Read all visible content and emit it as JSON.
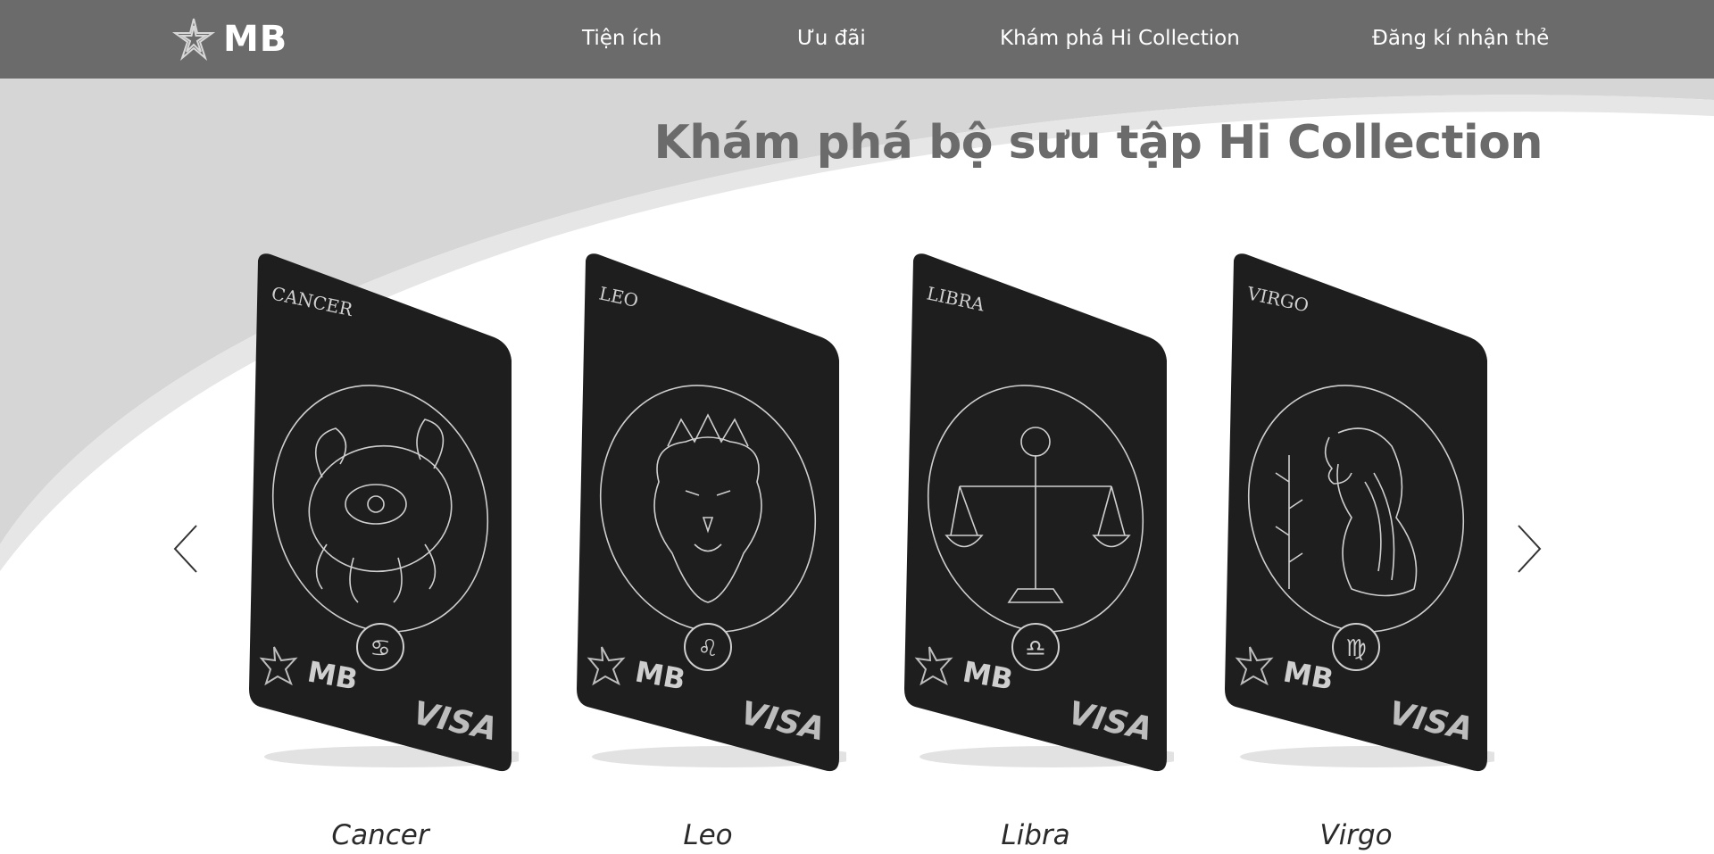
{
  "header": {
    "logo_text": "MB",
    "nav": [
      {
        "label": "Tiện ích"
      },
      {
        "label": "Ưu đãi"
      },
      {
        "label": "Khám phá Hi Collection"
      },
      {
        "label": "Đăng kí nhận thẻ"
      }
    ]
  },
  "main": {
    "title": "Khám phá bộ sưu tập Hi Collection"
  },
  "carousel": {
    "cards": [
      {
        "card_label": "CANCER",
        "caption": "Cancer",
        "symbol": "♋",
        "brand": "MB",
        "network": "VISA"
      },
      {
        "card_label": "LEO",
        "caption": "Leo",
        "symbol": "♌",
        "brand": "MB",
        "network": "VISA"
      },
      {
        "card_label": "LIBRA",
        "caption": "Libra",
        "symbol": "♎",
        "brand": "MB",
        "network": "VISA"
      },
      {
        "card_label": "VIRGO",
        "caption": "Virgo",
        "symbol": "♍",
        "brand": "MB",
        "network": "VISA"
      }
    ]
  },
  "colors": {
    "header_bg": "#6b6b6b",
    "title": "#6b6b6b",
    "card_bg": "#1e1e1e",
    "swoosh": "#d6d6d6"
  }
}
